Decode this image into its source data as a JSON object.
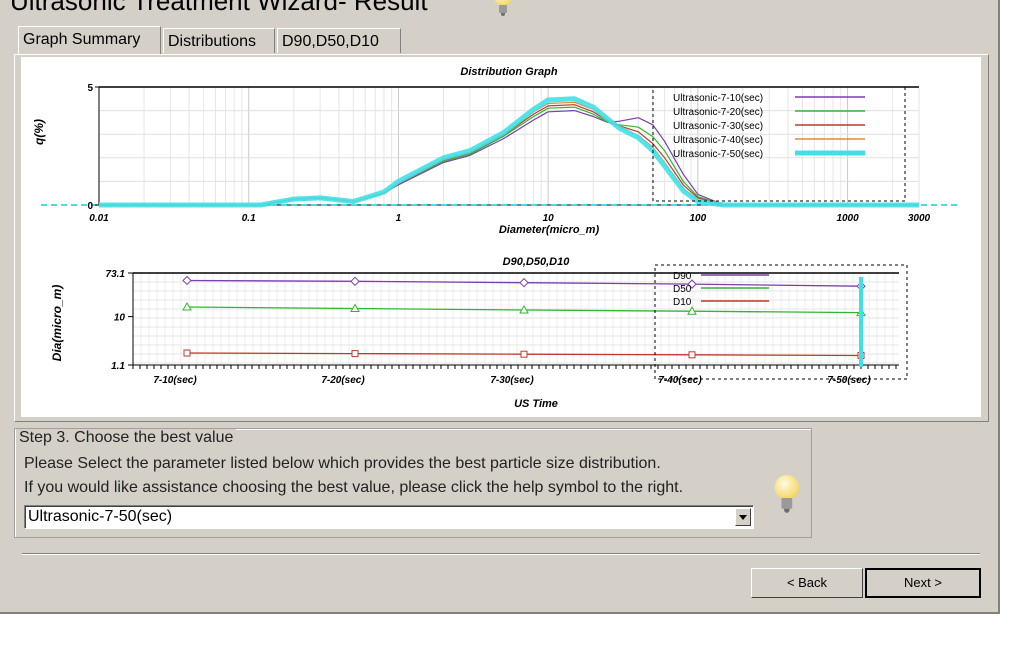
{
  "window": {
    "title": "Ultrasonic Treatment Wizard- Result"
  },
  "tabs": [
    {
      "label": "Graph Summary",
      "active": true
    },
    {
      "label": "Distributions",
      "active": false
    },
    {
      "label": "D90,D50,D10",
      "active": false
    }
  ],
  "step": {
    "legend": "Step 3. Choose the best value",
    "line1": "Please Select the parameter listed below which provides the best particle size distribution.",
    "line2": "If you would like assistance choosing the best value, please click the help symbol to the right.",
    "selected": "Ultrasonic-7-50(sec)"
  },
  "buttons": {
    "back": "< Back",
    "next": "Next >"
  },
  "chart_data": [
    {
      "type": "line",
      "title": "Distribution Graph",
      "xlabel": "Diameter(micro_m)",
      "ylabel": "q(%)",
      "xscale": "log",
      "xlim": [
        0.01,
        3000
      ],
      "ylim": [
        0,
        5
      ],
      "x_ticks": [
        "0.01",
        "0.1",
        "1",
        "10",
        "100",
        "1000",
        "3000"
      ],
      "x_tick_values": [
        0.01,
        0.1,
        1,
        10,
        100,
        1000,
        3000
      ],
      "y_ticks": [
        "0",
        "5"
      ],
      "y_tick_values": [
        0,
        5
      ],
      "legend_position": "top-right",
      "series": [
        {
          "name": "Ultrasonic-7-10(sec)",
          "color": "#7a3fb0",
          "x": [
            0.01,
            0.12,
            0.2,
            0.3,
            0.5,
            0.8,
            1,
            2,
            3,
            5,
            8,
            10,
            15,
            20,
            25,
            30,
            40,
            50,
            60,
            80,
            100,
            150,
            3000
          ],
          "y": [
            0,
            0,
            0.25,
            0.3,
            0.15,
            0.5,
            0.85,
            1.8,
            2.1,
            2.8,
            3.6,
            3.95,
            4.0,
            3.75,
            3.5,
            3.55,
            3.7,
            3.4,
            2.7,
            1.3,
            0.45,
            0,
            0
          ]
        },
        {
          "name": "Ultrasonic-7-20(sec)",
          "color": "#2eb82e",
          "x": [
            0.01,
            0.12,
            0.2,
            0.3,
            0.5,
            0.8,
            1,
            2,
            3,
            5,
            8,
            10,
            15,
            20,
            25,
            30,
            40,
            50,
            60,
            80,
            100,
            150,
            3000
          ],
          "y": [
            0,
            0,
            0.25,
            0.3,
            0.15,
            0.5,
            0.9,
            1.85,
            2.15,
            2.9,
            3.75,
            4.1,
            4.15,
            3.85,
            3.5,
            3.4,
            3.3,
            2.9,
            2.3,
            1.0,
            0.35,
            0,
            0
          ]
        },
        {
          "name": "Ultrasonic-7-30(sec)",
          "color": "#c0392b",
          "x": [
            0.01,
            0.12,
            0.2,
            0.3,
            0.5,
            0.8,
            1,
            2,
            3,
            5,
            8,
            10,
            15,
            20,
            25,
            30,
            40,
            50,
            60,
            80,
            100,
            150,
            3000
          ],
          "y": [
            0,
            0,
            0.25,
            0.3,
            0.15,
            0.5,
            0.9,
            1.9,
            2.2,
            2.95,
            3.85,
            4.2,
            4.25,
            3.95,
            3.55,
            3.35,
            3.1,
            2.6,
            2.0,
            0.85,
            0.3,
            0,
            0
          ]
        },
        {
          "name": "Ultrasonic-7-40(sec)",
          "color": "#e08a3c",
          "x": [
            0.01,
            0.12,
            0.2,
            0.3,
            0.5,
            0.8,
            1,
            2,
            3,
            5,
            8,
            10,
            15,
            20,
            25,
            30,
            40,
            50,
            60,
            80,
            100,
            150,
            3000
          ],
          "y": [
            0,
            0,
            0.25,
            0.3,
            0.15,
            0.52,
            0.95,
            1.95,
            2.25,
            3.0,
            3.95,
            4.3,
            4.35,
            4.05,
            3.6,
            3.3,
            2.95,
            2.45,
            1.8,
            0.7,
            0.2,
            0,
            0
          ]
        },
        {
          "name": "Ultrasonic-7-50(sec)",
          "color": "#40e0e8",
          "x": [
            0.01,
            0.12,
            0.2,
            0.3,
            0.5,
            0.8,
            1,
            2,
            3,
            5,
            8,
            10,
            15,
            20,
            25,
            30,
            40,
            50,
            60,
            80,
            100,
            150,
            3000
          ],
          "y": [
            0,
            0,
            0.25,
            0.3,
            0.15,
            0.55,
            1.0,
            2.0,
            2.3,
            3.05,
            4.05,
            4.45,
            4.5,
            4.15,
            3.65,
            3.25,
            2.85,
            2.3,
            1.65,
            0.6,
            0.15,
            0,
            0
          ]
        }
      ]
    },
    {
      "type": "line",
      "title": "D90,D50,D10",
      "xlabel": "US Time",
      "ylabel": "Dia(micro_m)",
      "yscale": "log",
      "ylim": [
        1.1,
        73.1
      ],
      "y_ticks": [
        "1.1",
        "10",
        "73.1"
      ],
      "y_tick_values": [
        1.1,
        10,
        73.1
      ],
      "categories": [
        "7-10(sec)",
        "7-20(sec)",
        "7-30(sec)",
        "7-40(sec)",
        "7-50(sec)"
      ],
      "legend_position": "top-right",
      "series": [
        {
          "name": "D90",
          "color": "#7a3fb0",
          "values": [
            52,
            50,
            47,
            44,
            40
          ]
        },
        {
          "name": "D50",
          "color": "#2eb82e",
          "values": [
            15.5,
            14.5,
            13.5,
            12.8,
            12
          ]
        },
        {
          "name": "D10",
          "color": "#c0392b",
          "values": [
            1.9,
            1.85,
            1.8,
            1.75,
            1.7
          ]
        }
      ]
    }
  ]
}
